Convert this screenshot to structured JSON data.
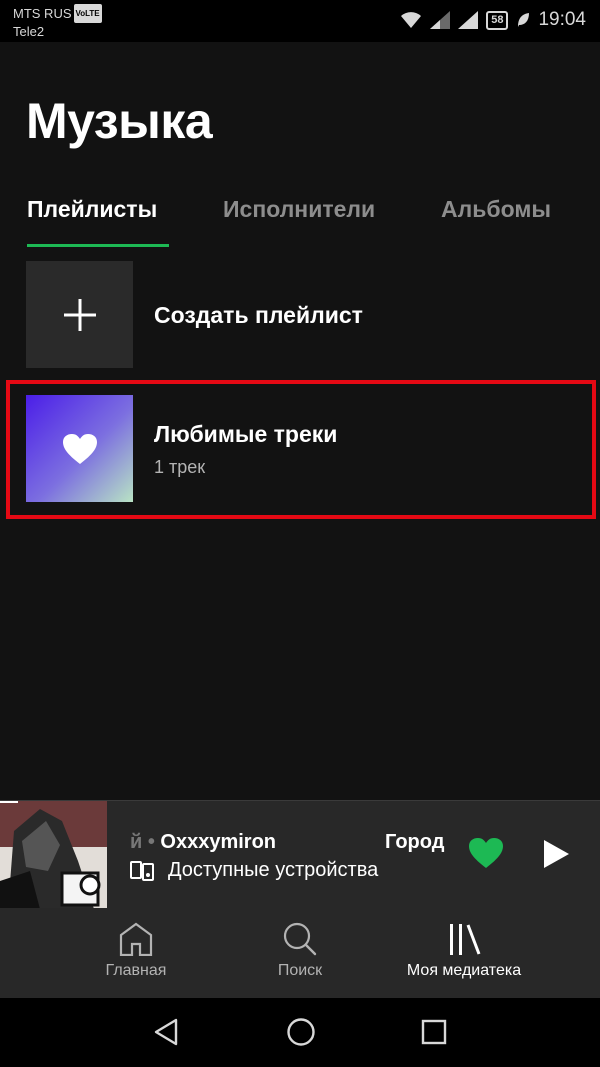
{
  "statusbar": {
    "carrier1": "MTS RUS",
    "volte": "VoLTE",
    "carrier2": "Tele2",
    "battery": "58",
    "time": "19:04"
  },
  "page": {
    "title": "Музыка"
  },
  "tabs": [
    {
      "label": "Плейлисты",
      "active": true
    },
    {
      "label": "Исполнители",
      "active": false
    },
    {
      "label": "Альбомы",
      "active": false
    }
  ],
  "playlists": [
    {
      "title": "Создать плейлист",
      "icon": "plus-icon"
    },
    {
      "title": "Любимые треки",
      "subtitle": "1 трек",
      "icon": "heart-icon"
    }
  ],
  "now_playing": {
    "track_prefix": "й • ",
    "artist": "Oxxxymiron",
    "title_fragment": "Город",
    "device_label": "Доступные устройства",
    "liked": true
  },
  "bottom_nav": [
    {
      "label": "Главная",
      "icon": "home-icon"
    },
    {
      "label": "Поиск",
      "icon": "search-icon"
    },
    {
      "label": "Моя медиатека",
      "icon": "library-icon",
      "active": true
    }
  ],
  "colors": {
    "accent": "#1db954",
    "background": "#121212",
    "highlight": "#e50914"
  }
}
